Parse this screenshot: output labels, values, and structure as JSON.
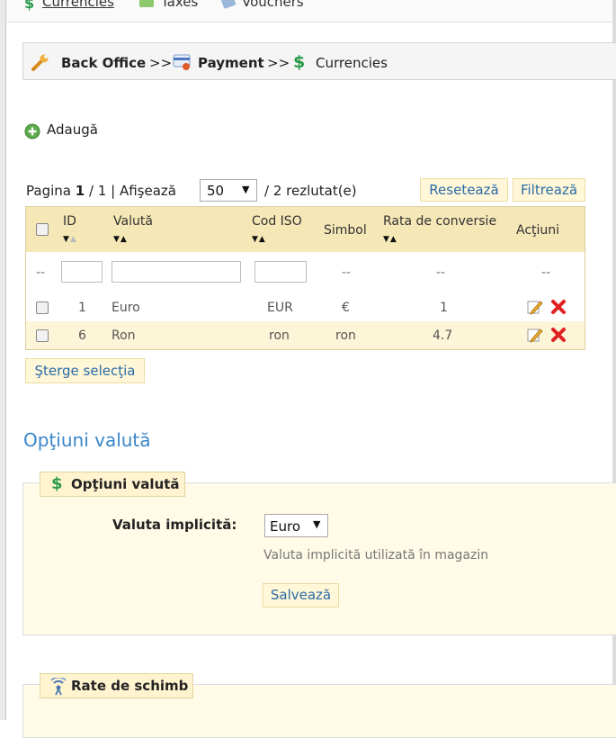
{
  "topnav": {
    "items": [
      "Currencies",
      "Taxes",
      "Vouchers"
    ]
  },
  "breadcrumb": {
    "back_office": "Back Office",
    "sep1": ">>",
    "payment": "Payment",
    "sep2": ">>",
    "currencies": "Currencies"
  },
  "add": {
    "label": "Adaugă"
  },
  "pagination": {
    "page_label": "Pagina",
    "page": "1",
    "sep": "/",
    "total_pages": "1",
    "pipe": "|",
    "show_label": "Afişează",
    "per_page": "50",
    "results": "/ 2 rezlutat(e)"
  },
  "buttons": {
    "reset": "Resetează",
    "filter": "Filtrează",
    "delete_selection": "Şterge selecţia",
    "save": "Salvează"
  },
  "table": {
    "headers": {
      "id": "ID",
      "currency": "Valută",
      "iso": "Cod ISO",
      "symbol": "Simbol",
      "rate": "Rata de conversie",
      "actions": "Acţiuni"
    },
    "filter_row": {
      "dash": "--"
    },
    "rows": [
      {
        "id": "1",
        "currency": "Euro",
        "iso": "EUR",
        "symbol": "€",
        "rate": "1"
      },
      {
        "id": "6",
        "currency": "Ron",
        "iso": "ron",
        "symbol": "ron",
        "rate": "4.7"
      }
    ]
  },
  "options": {
    "section_title": "Opţiuni valută",
    "legend": "Opţiuni valută",
    "default_label": "Valuta implicită:",
    "default_value": "Euro",
    "hint": "Valuta implicită utilizată în magazin"
  },
  "exchange": {
    "legend": "Rate de schimb"
  },
  "colors": {
    "link_blue": "#2a6aa6",
    "header_bg": "#f5e7b6",
    "alt_row": "#fdf5d8",
    "accent_blue": "#3a86c8",
    "delete_red": "#e02020"
  }
}
